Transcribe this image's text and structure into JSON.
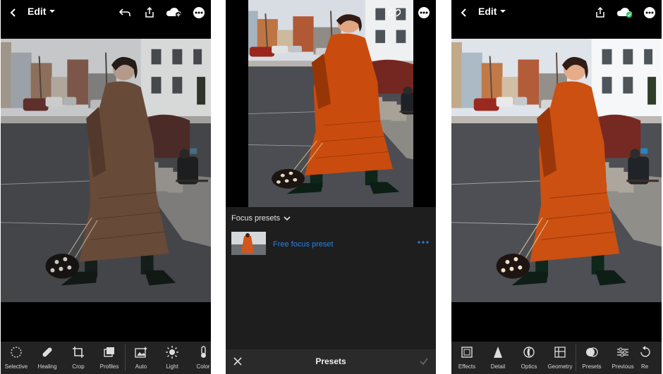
{
  "panel_left": {
    "header": {
      "title": "Edit"
    },
    "tools": [
      {
        "label": "Selective",
        "icon": "selective-icon"
      },
      {
        "label": "Healing",
        "icon": "healing-icon"
      },
      {
        "label": "Crop",
        "icon": "crop-icon"
      },
      {
        "label": "Profiles",
        "icon": "profiles-icon"
      },
      {
        "label": "Auto",
        "icon": "auto-icon"
      },
      {
        "label": "Light",
        "icon": "light-icon"
      },
      {
        "label": "Color",
        "icon": "color-icon"
      }
    ]
  },
  "panel_middle": {
    "presets": {
      "group_label": "Focus presets",
      "items": [
        {
          "name": "Free focus preset"
        }
      ],
      "bottom_title": "Presets"
    }
  },
  "panel_right": {
    "header": {
      "title": "Edit"
    },
    "tools": [
      {
        "label": "Effects",
        "icon": "effects-icon"
      },
      {
        "label": "Detail",
        "icon": "detail-icon"
      },
      {
        "label": "Optics",
        "icon": "optics-icon"
      },
      {
        "label": "Geometry",
        "icon": "geometry-icon"
      },
      {
        "label": "Presets",
        "icon": "presets-icon"
      },
      {
        "label": "Previous",
        "icon": "previous-icon"
      },
      {
        "label": "Re",
        "icon": "reset-icon"
      }
    ]
  },
  "colors": {
    "accent_blue": "#2c80e4",
    "sync_green": "#31c36b",
    "coat_muted": "#8a4e2a",
    "coat_vivid": "#b8501c"
  }
}
